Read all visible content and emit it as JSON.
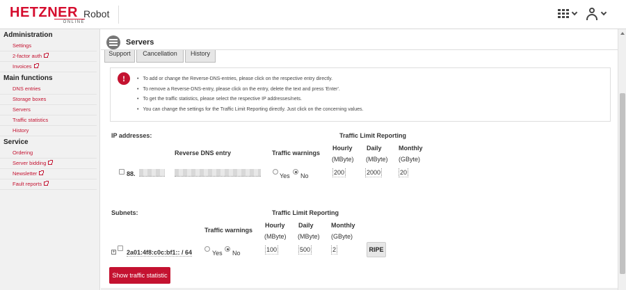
{
  "header": {
    "brand": "HETZNER",
    "brand_sub": "ONLINE",
    "app_name": "Robot"
  },
  "sidebar": {
    "sections": [
      {
        "title": "Administration",
        "items": [
          {
            "label": "Settings",
            "external": false
          },
          {
            "label": "2-factor auth",
            "external": true
          },
          {
            "label": "Invoices",
            "external": true
          }
        ]
      },
      {
        "title": "Main functions",
        "items": [
          {
            "label": "DNS entries",
            "external": false
          },
          {
            "label": "Storage boxes",
            "external": false
          },
          {
            "label": "Servers",
            "external": false
          },
          {
            "label": "Traffic statistics",
            "external": false
          },
          {
            "label": "History",
            "external": false
          }
        ]
      },
      {
        "title": "Service",
        "items": [
          {
            "label": "Ordering",
            "external": false
          },
          {
            "label": "Server bidding",
            "external": true
          },
          {
            "label": "Newsletter",
            "external": true
          },
          {
            "label": "Fault reports",
            "external": true
          }
        ]
      }
    ]
  },
  "page": {
    "title": "Servers",
    "tabs": [
      "Support",
      "Cancellation",
      "History"
    ]
  },
  "info": {
    "icon": "!",
    "lines": [
      "To add or change the Reverse-DNS-entries, please click on the respective entry directly.",
      "To remove a Reverse-DNS-entry, please click on the entry, delete the text and press 'Enter'.",
      "To get the traffic statistics, please select the respective IP addresses/nets.",
      "You can change the settings for the Traffic Limit Reporting directly. Just click on the concerning values."
    ]
  },
  "ip_section": {
    "title": "IP addresses:",
    "traffic_limit_title": "Traffic Limit Reporting",
    "col_rdns": "Reverse DNS entry",
    "col_warnings": "Traffic warnings",
    "col_hourly": "Hourly",
    "col_daily": "Daily",
    "col_monthly": "Monthly",
    "unit_hourly": "(MByte)",
    "unit_daily": "(MByte)",
    "unit_monthly": "(GByte)",
    "row": {
      "ip": "88.",
      "yes_label": "Yes",
      "no_label": "No",
      "hourly": "200",
      "daily": "2000",
      "monthly": "20"
    }
  },
  "subnet_section": {
    "title": "Subnets:",
    "traffic_limit_title": "Traffic Limit Reporting",
    "col_warnings": "Traffic warnings",
    "col_hourly": "Hourly",
    "col_daily": "Daily",
    "col_monthly": "Monthly",
    "unit_hourly": "(MByte)",
    "unit_daily": "(MByte)",
    "unit_monthly": "(GByte)",
    "row": {
      "subnet": "2a01:4f8:c0c:bf1:: / 64",
      "yes_label": "Yes",
      "no_label": "No",
      "hourly": "100",
      "daily": "500",
      "monthly": "2",
      "ripe_label": "RIPE"
    }
  },
  "actions": {
    "show_traffic": "Show traffic statistic"
  },
  "colors": {
    "accent": "#c41230",
    "sidebar_bg": "#f1f1f1"
  }
}
